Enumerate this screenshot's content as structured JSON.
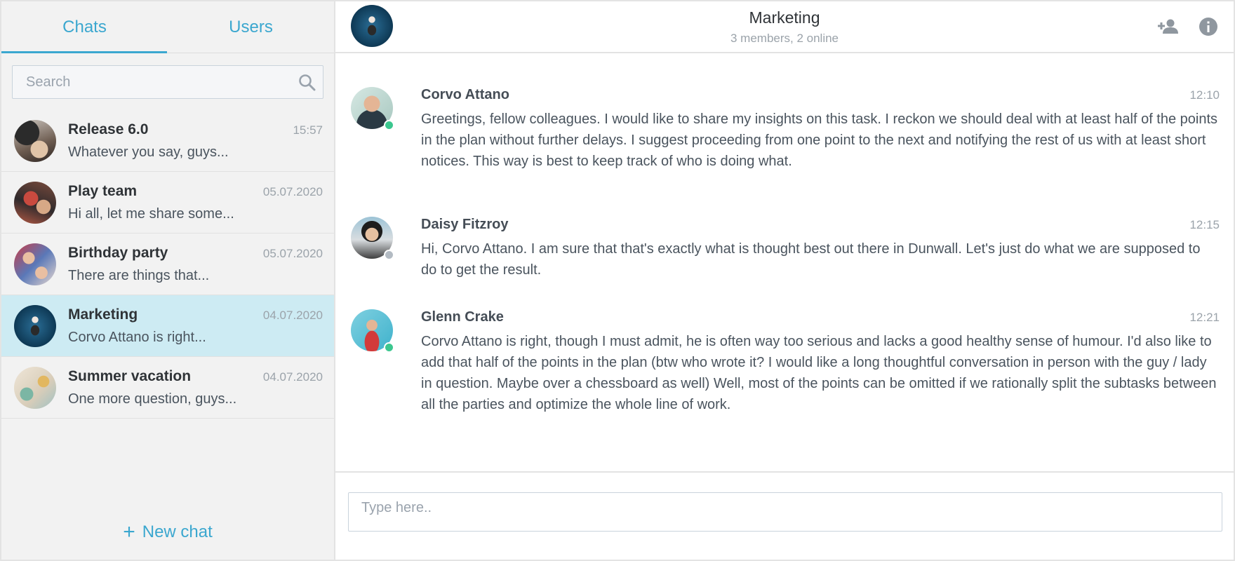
{
  "sidebar": {
    "tabs": [
      {
        "label": "Chats",
        "active": true
      },
      {
        "label": "Users",
        "active": false
      }
    ],
    "search": {
      "placeholder": "Search",
      "value": ""
    },
    "chats": [
      {
        "name": "Release 6.0",
        "time": "15:57",
        "preview": "Whatever you say, guys...",
        "active": false
      },
      {
        "name": "Play team",
        "time": "05.07.2020",
        "preview": "Hi all, let me share some...",
        "active": false
      },
      {
        "name": "Birthday party",
        "time": "05.07.2020",
        "preview": "There are things that...",
        "active": false
      },
      {
        "name": "Marketing",
        "time": "04.07.2020",
        "preview": "Corvo Attano is right...",
        "active": true
      },
      {
        "name": "Summer vacation",
        "time": "04.07.2020",
        "preview": "One more question, guys...",
        "active": false
      }
    ],
    "new_chat_label": "New chat"
  },
  "header": {
    "title": "Marketing",
    "subtitle": "3 members, 2 online",
    "icons": [
      "add-user-icon",
      "info-icon"
    ]
  },
  "messages": [
    {
      "author": "Corvo Attano",
      "time": "12:10",
      "online": true,
      "text": "Greetings, fellow colleagues. I would like to share my insights on this task. I reckon we should deal with at least half of the points in the plan without further delays. I suggest proceeding from one point to the next and notifying the rest of us with at least short notices. This way is best to keep track of who is doing what."
    },
    {
      "author": "Daisy Fitzroy",
      "time": "12:15",
      "online": false,
      "text": "Hi, Corvo Attano. I am sure that that's exactly what is thought best out there in Dunwall. Let's just do what we are supposed to do to get the result."
    },
    {
      "author": "Glenn Crake",
      "time": "12:21",
      "online": true,
      "text": "Corvo Attano is right, though I must admit, he is often way too serious and lacks a good healthy sense of humour. I'd also like to add that half of the points in the plan (btw who wrote it? I would like a long thoughtful conversation in person with the guy / lady in question. Maybe over a chessboard as well) Well, most of the points can be omitted if we rationally split the subtasks between all the parties and optimize the whole line of work."
    }
  ],
  "composer": {
    "placeholder": "Type here..",
    "value": ""
  },
  "colors": {
    "accent": "#3ba7cf",
    "active_row": "#cdebf3",
    "online": "#3cc78f",
    "offline": "#b3bbc3"
  }
}
